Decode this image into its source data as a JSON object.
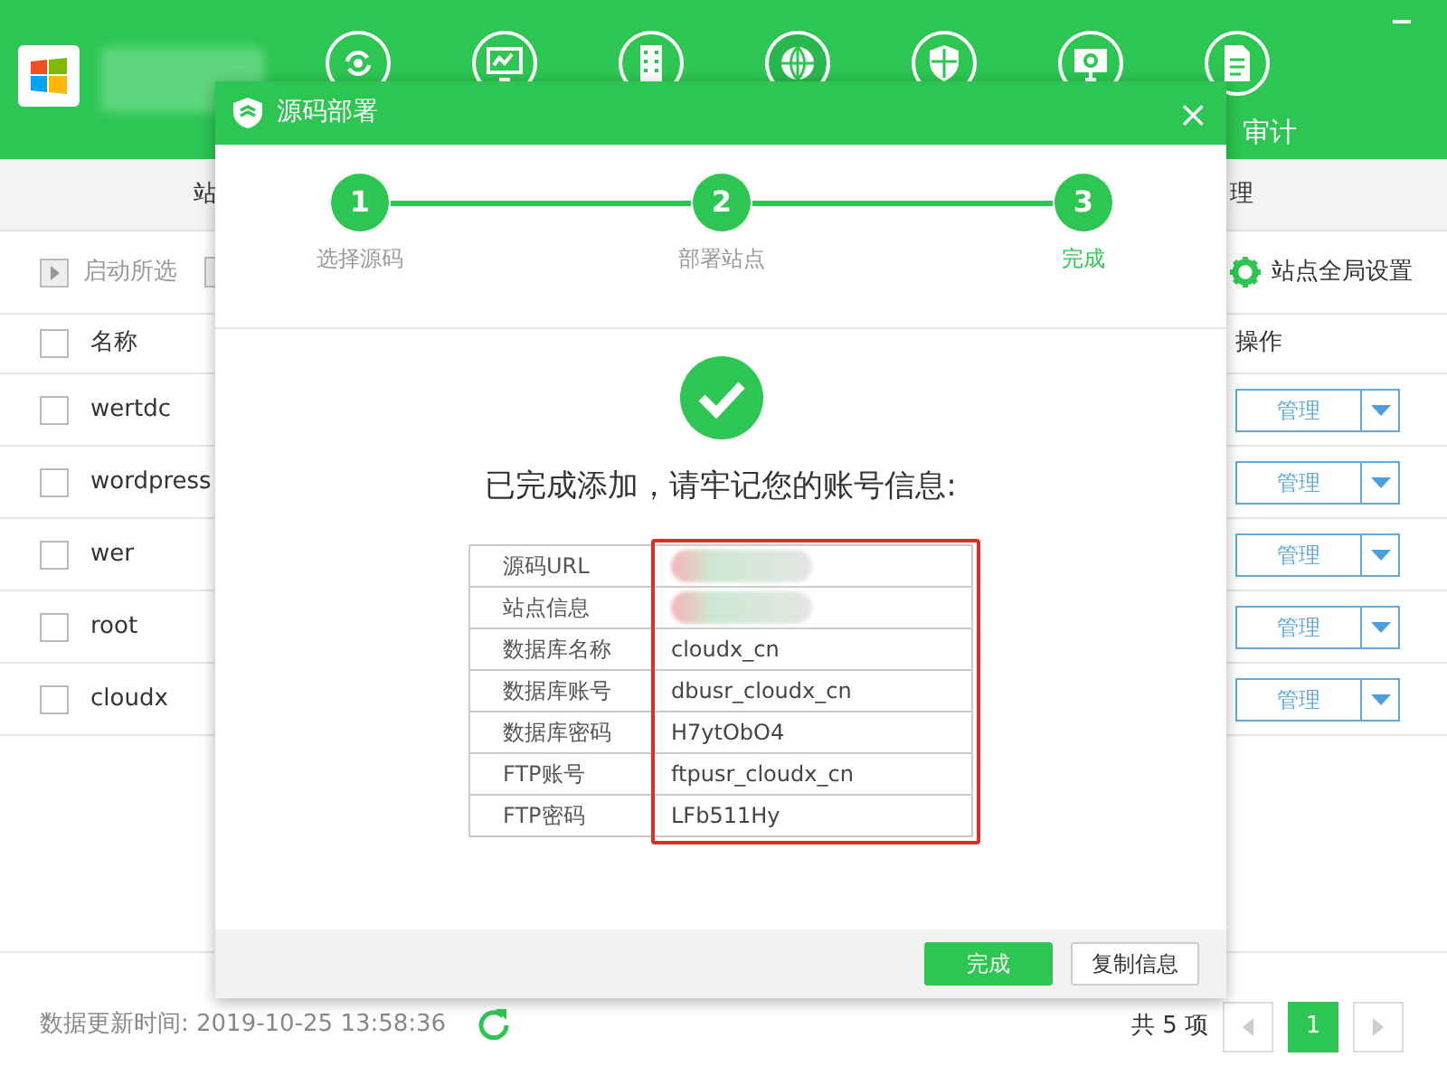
{
  "app": {
    "header_icons": [
      {
        "kind": "sync"
      },
      {
        "kind": "monitor"
      },
      {
        "kind": "building"
      },
      {
        "kind": "globe",
        "selected": true
      },
      {
        "kind": "shield"
      },
      {
        "kind": "gear-screen"
      },
      {
        "kind": "document",
        "label": "审计"
      }
    ],
    "tabs": [
      {
        "label": "站"
      },
      {
        "label": "理"
      }
    ],
    "toolbar": {
      "start_selected": "启动所选",
      "global_settings": "站点全局设置"
    },
    "table": {
      "columns": [
        "名称",
        "操作"
      ],
      "all_checked": false,
      "rows": [
        {
          "name": "wertdc",
          "checked": false,
          "action": "管理"
        },
        {
          "name": "wordpress",
          "checked": false,
          "action": "管理"
        },
        {
          "name": "wer",
          "checked": false,
          "action": "管理"
        },
        {
          "name": "root",
          "checked": false,
          "action": "管理"
        },
        {
          "name": "cloudx",
          "checked": false,
          "action": "管理"
        }
      ]
    },
    "footer": {
      "update_time": "数据更新时间: 2019-10-25 13:58:36",
      "total": "共 5 项",
      "pages": [
        {
          "label": "1",
          "selected": true
        }
      ]
    }
  },
  "dialog": {
    "title": "源码部署",
    "close": "×",
    "steps": [
      {
        "number": "1",
        "label": "选择源码",
        "current": false
      },
      {
        "number": "2",
        "label": "部署站点",
        "current": false
      },
      {
        "number": "3",
        "label": "完成",
        "current": true
      }
    ],
    "message": "已完成添加，请牢记您的账号信息:",
    "info": [
      {
        "label": "源码URL",
        "kind": "blurred"
      },
      {
        "label": "站点信息",
        "kind": "blurred"
      },
      {
        "label": "数据库名称",
        "value": "cloudx_cn"
      },
      {
        "label": "数据库账号",
        "value": "dbusr_cloudx_cn"
      },
      {
        "label": "数据库密码",
        "value": "H7ytObO4"
      },
      {
        "label": "FTP账号",
        "value": "ftpusr_cloudx_cn"
      },
      {
        "label": "FTP密码",
        "value": "LFb511Hy"
      }
    ],
    "buttons": [
      {
        "label": "完成",
        "kind": "primary"
      },
      {
        "label": "复制信息",
        "kind": "secondary"
      }
    ]
  }
}
